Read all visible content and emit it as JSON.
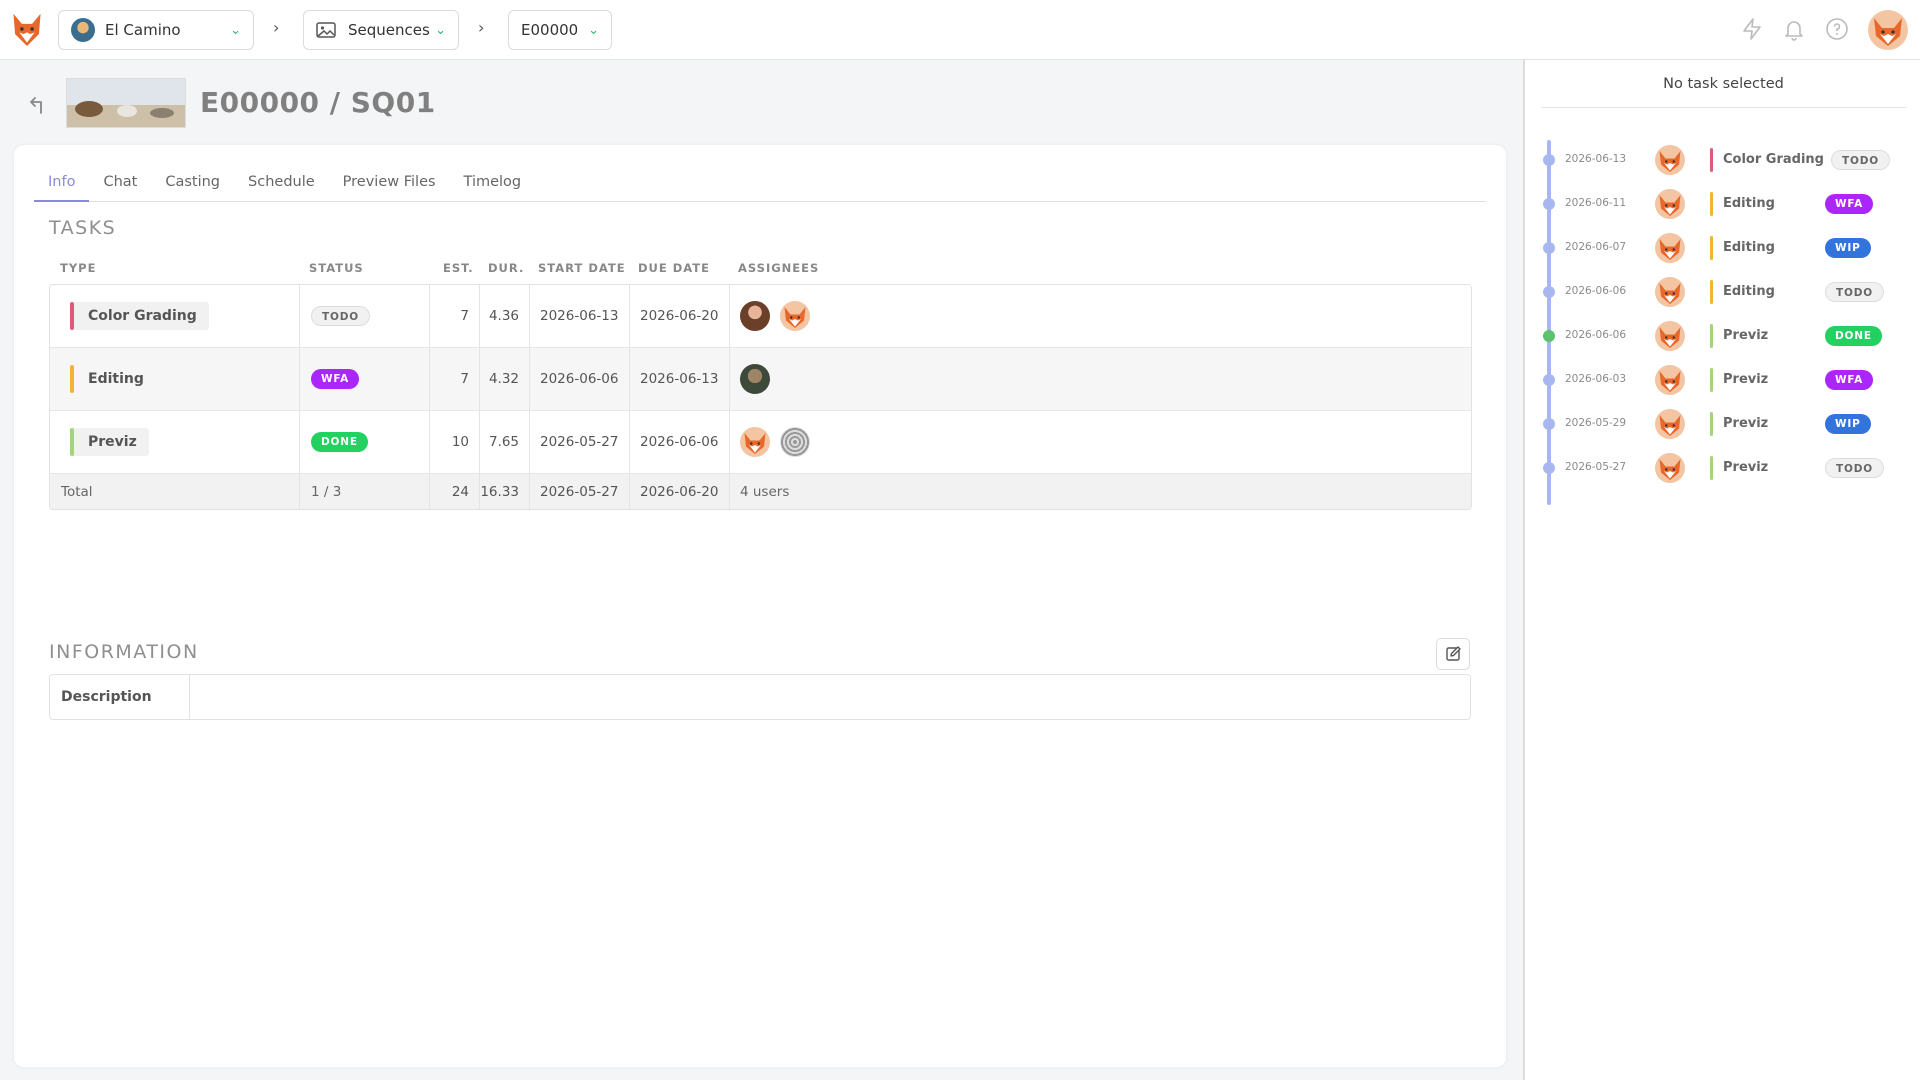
{
  "topbar": {
    "production": "El Camino",
    "section": "Sequences",
    "episode": "E00000"
  },
  "header": {
    "title": "E00000 / SQ01"
  },
  "tabs": [
    {
      "label": "Info",
      "active": true
    },
    {
      "label": "Chat",
      "active": false
    },
    {
      "label": "Casting",
      "active": false
    },
    {
      "label": "Schedule",
      "active": false
    },
    {
      "label": "Preview Files",
      "active": false
    },
    {
      "label": "Timelog",
      "active": false
    }
  ],
  "tasks": {
    "title": "TASKS",
    "columns": {
      "type": "TYPE",
      "status": "STATUS",
      "est": "EST.",
      "dur": "DUR.",
      "start": "START DATE",
      "due": "DUE DATE",
      "assignees": "ASSIGNEES"
    },
    "rows": [
      {
        "type": "Color Grading",
        "type_color": "#e05a7a",
        "status": "TODO",
        "est": "7",
        "dur": "4.36",
        "start": "2026-06-13",
        "due": "2026-06-20"
      },
      {
        "type": "Editing",
        "type_color": "#f5b335",
        "status": "WFA",
        "est": "7",
        "dur": "4.32",
        "start": "2026-06-06",
        "due": "2026-06-13"
      },
      {
        "type": "Previz",
        "type_color": "#a3d67c",
        "status": "DONE",
        "est": "10",
        "dur": "7.65",
        "start": "2026-05-27",
        "due": "2026-06-06"
      }
    ],
    "total": {
      "label": "Total",
      "status": "1 / 3",
      "est": "24",
      "dur": "16.33",
      "start": "2026-05-27",
      "due": "2026-06-20",
      "assignees": "4 users"
    }
  },
  "information": {
    "title": "INFORMATION",
    "description_label": "Description",
    "description_value": ""
  },
  "side_panel": {
    "no_task": "No task selected",
    "timeline": [
      {
        "date": "2026-06-13",
        "type": "Color Grading",
        "type_color": "#e05a7a",
        "status": "TODO",
        "dot_color": "#a9b7f1"
      },
      {
        "date": "2026-06-11",
        "type": "Editing",
        "type_color": "#f5b335",
        "status": "WFA",
        "dot_color": "#a9b7f1"
      },
      {
        "date": "2026-06-07",
        "type": "Editing",
        "type_color": "#f5b335",
        "status": "WIP",
        "dot_color": "#a9b7f1"
      },
      {
        "date": "2026-06-06",
        "type": "Editing",
        "type_color": "#f5b335",
        "status": "TODO",
        "dot_color": "#a9b7f1"
      },
      {
        "date": "2026-06-06",
        "type": "Previz",
        "type_color": "#a3d67c",
        "status": "DONE",
        "dot_color": "#5cc26b"
      },
      {
        "date": "2026-06-03",
        "type": "Previz",
        "type_color": "#a3d67c",
        "status": "WFA",
        "dot_color": "#a9b7f1"
      },
      {
        "date": "2026-05-29",
        "type": "Previz",
        "type_color": "#a3d67c",
        "status": "WIP",
        "dot_color": "#a9b7f1"
      },
      {
        "date": "2026-05-27",
        "type": "Previz",
        "type_color": "#a3d67c",
        "status": "TODO",
        "dot_color": "#a9b7f1"
      }
    ]
  },
  "icons": {
    "logo": "fox-logo-icon",
    "sequences": "image-icon",
    "chevron": "chevron-down-icon",
    "breadcrumb_sep": "chevron-right-icon",
    "lightning": "lightning-icon",
    "bell": "bell-icon",
    "help": "help-icon",
    "back": "back-arrow-icon",
    "edit": "edit-icon"
  },
  "colors": {
    "accent": "#8a8ad8",
    "todo": "#f1f1f1",
    "wfa": "#ab26fa",
    "wip": "#3273dc",
    "done": "#22d160"
  }
}
